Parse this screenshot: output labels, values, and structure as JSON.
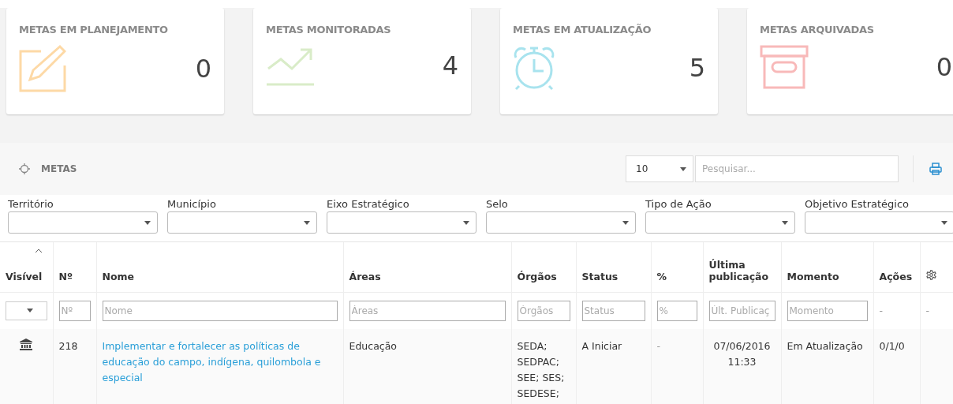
{
  "cards": [
    {
      "title": "METAS EM PLANEJAMENTO",
      "count": "0",
      "kind": "edit",
      "color": "#fdd9a6"
    },
    {
      "title": "METAS MONITORADAS",
      "count": "4",
      "kind": "chart",
      "color": "#d9ecc8"
    },
    {
      "title": "METAS EM ATUALIZAÇÃO",
      "count": "5",
      "kind": "alarm",
      "color": "#a8e3ee"
    },
    {
      "title": "METAS ARQUIVADAS",
      "count": "0",
      "kind": "archive",
      "color": "#f8b9b9"
    }
  ],
  "panel": {
    "title": "METAS",
    "page_size": "10",
    "search": {
      "placeholder": "Pesquisar..."
    }
  },
  "filters": [
    {
      "label": "Território"
    },
    {
      "label": "Município"
    },
    {
      "label": "Eixo Estratégico"
    },
    {
      "label": "Selo"
    },
    {
      "label": "Tipo de Ação"
    },
    {
      "label": "Objetivo Estratégico"
    }
  ],
  "table": {
    "columns": [
      {
        "label": "Visível",
        "kind": "select",
        "sorted": true
      },
      {
        "label": "Nº",
        "kind": "text",
        "placeholder": "Nº"
      },
      {
        "label": "Nome",
        "kind": "text",
        "placeholder": "Nome"
      },
      {
        "label": "Áreas",
        "kind": "text",
        "placeholder": "Áreas"
      },
      {
        "label": "Órgãos",
        "kind": "text",
        "placeholder": "Órgãos"
      },
      {
        "label": "Status",
        "kind": "text",
        "placeholder": "Status"
      },
      {
        "label": "%",
        "kind": "text",
        "placeholder": "%"
      },
      {
        "label": "Última publicação",
        "kind": "text",
        "placeholder": "Últ. Publicaç"
      },
      {
        "label": "Momento",
        "kind": "text",
        "placeholder": "Momento"
      },
      {
        "label": "Ações",
        "kind": "dash",
        "dash": "-"
      },
      {
        "kind": "settings",
        "dash": "-"
      }
    ],
    "rows": [
      {
        "number": "218",
        "name": "Implementar e fortalecer as políticas de educação do campo, indígena, quilombola e especial",
        "areas": "Educação",
        "orgaos": [
          "SEDA;",
          "SEDPAC;",
          "SEE; SES;",
          "SEDESE;"
        ],
        "status": "A Iniciar",
        "percent": "-",
        "published": [
          "07/06/2016",
          "11:33"
        ],
        "momento": "Em Atualização",
        "acoes": "0/1/0"
      }
    ]
  }
}
